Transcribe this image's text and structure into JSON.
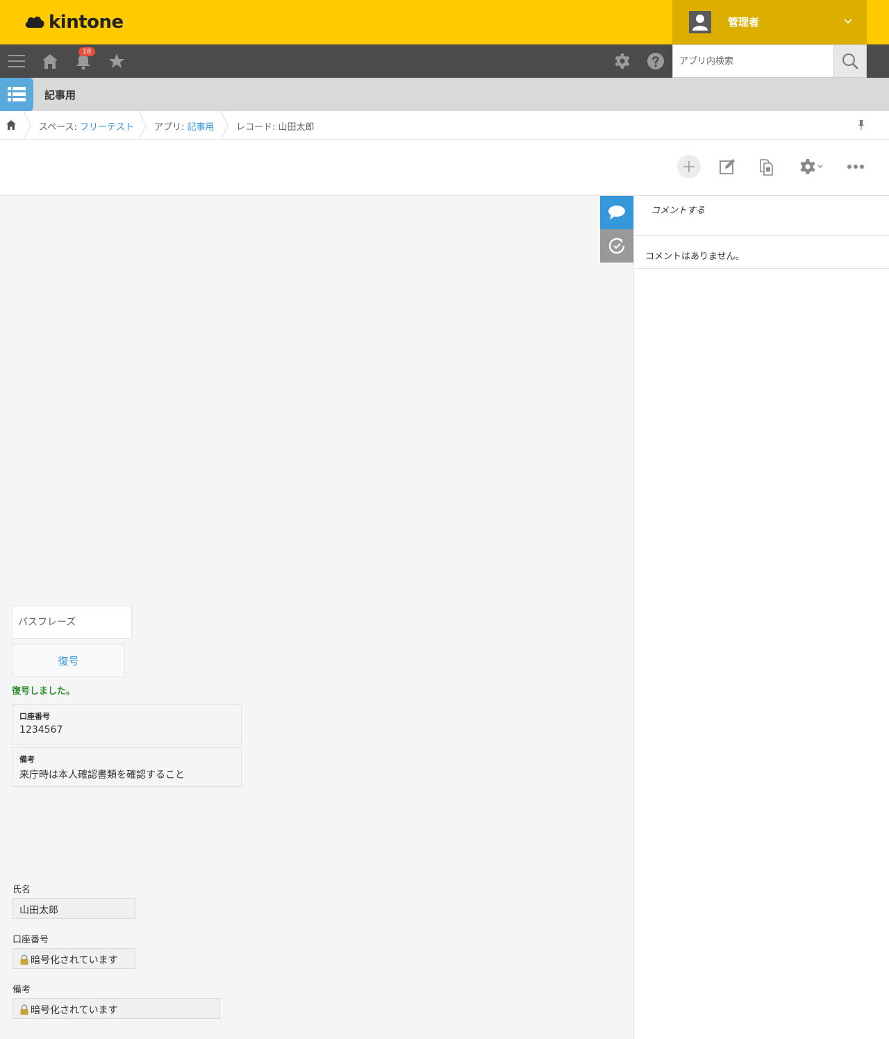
{
  "header": {
    "logo_text": "kintone",
    "user_name": "管理者"
  },
  "toolbar": {
    "notification_count": "18",
    "search_placeholder": "アプリ内検索"
  },
  "app": {
    "title": "記事用"
  },
  "breadcrumb": {
    "space_label": "スペース: ",
    "space_name": "フリーテスト",
    "app_label": "アプリ: ",
    "app_name": "記事用",
    "record_label": "レコード: 山田太郎"
  },
  "comments": {
    "input_placeholder": "コメントする",
    "empty_text": "コメントはありません。"
  },
  "decrypt": {
    "passphrase_placeholder": "パスフレーズ",
    "button_label": "復号",
    "success_message": "復号しました。",
    "fields": [
      {
        "label": "口座番号",
        "value": "1234567"
      },
      {
        "label": "備考",
        "value": "来庁時は本人確認書類を確認すること"
      }
    ]
  },
  "record": {
    "fields": [
      {
        "label": "氏名",
        "value": "山田太郎"
      },
      {
        "label": "口座番号",
        "value": "暗号化されています"
      },
      {
        "label": "備考",
        "value": "暗号化されています"
      }
    ]
  },
  "colors": {
    "header_yellow": "#ffcb00",
    "user_menu": "#dcae00",
    "toolbar_dark": "#4b4b4b",
    "link_blue": "#3498db",
    "success_green": "#2e8b2e",
    "badge_red": "#e74c3c"
  },
  "icons": {
    "logo": "kintone-cloud-icon",
    "menu": "hamburger-icon",
    "home": "home-icon",
    "notifications": "bell-icon",
    "favorites": "star-icon",
    "settings": "gear-icon",
    "help": "question-icon",
    "search": "search-icon",
    "app": "list-icon",
    "pin": "pin-icon",
    "add": "plus-icon",
    "edit": "pencil-icon",
    "duplicate": "copy-icon",
    "more": "ellipsis-icon",
    "comment": "comment-icon",
    "history": "history-icon",
    "lock": "lock-icon"
  }
}
